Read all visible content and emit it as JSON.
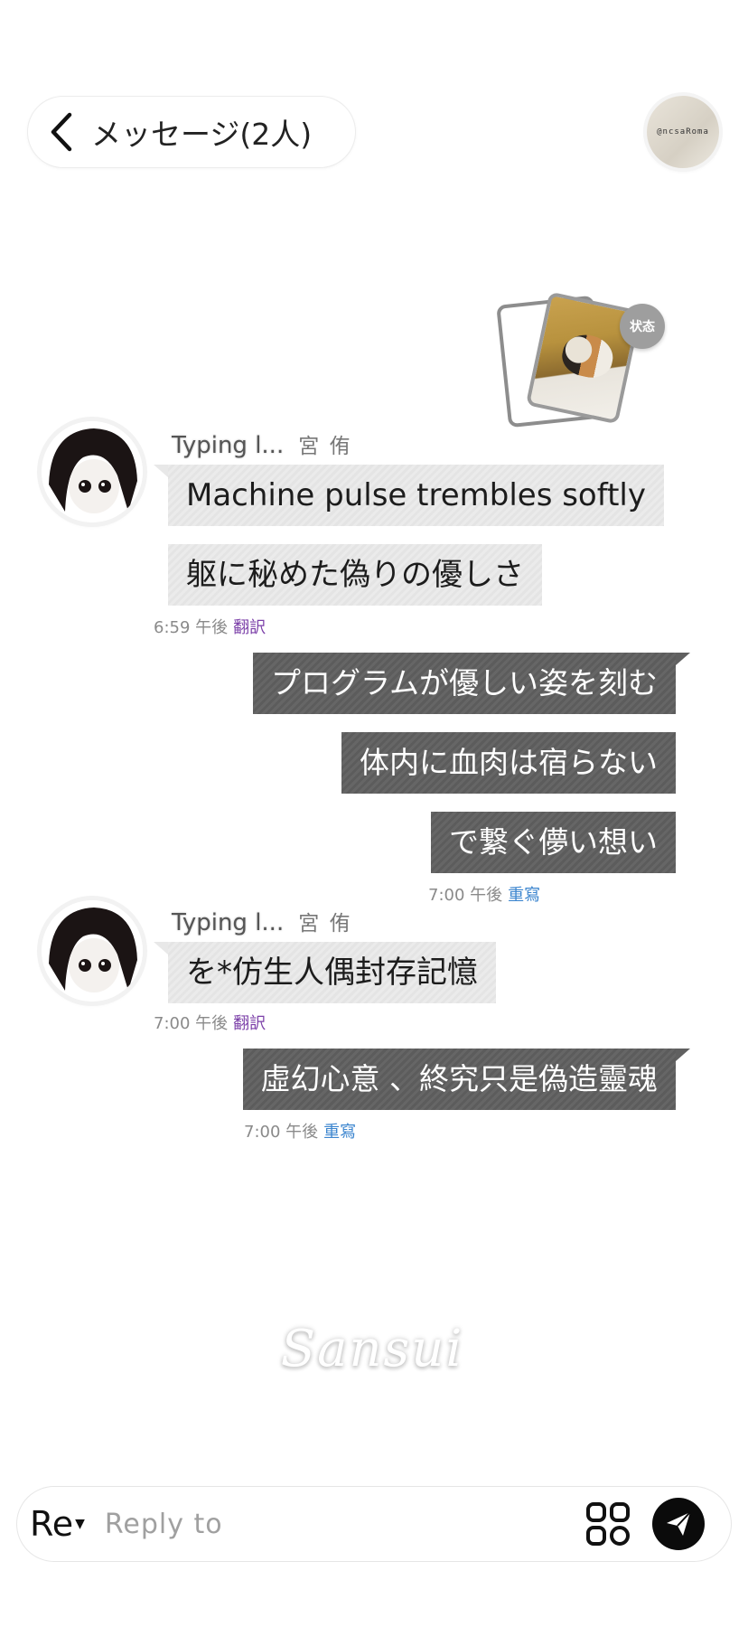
{
  "header": {
    "title": "メッセージ(2人)",
    "avatar_text": "@ncsaRoma"
  },
  "status": {
    "badge_label": "状态"
  },
  "messages": {
    "group1": {
      "typing_name": "Typing l...",
      "sender_name": "宮 侑",
      "bubbles": [
        "Machine pulse trembles softly",
        "躯に秘めた偽りの優しさ"
      ],
      "time": "6:59 午後",
      "action": "翻訳"
    },
    "group2": {
      "bubbles": [
        "プログラムが優しい姿を刻む",
        "体内に血肉は宿らない",
        "で繋ぐ儚い想い"
      ],
      "time": "7:00 午後",
      "action": "重寫"
    },
    "group3": {
      "typing_name": "Typing l...",
      "sender_name": "宮 侑",
      "bubbles": [
        "を*仿生人偶封存記憶"
      ],
      "time": "7:00 午後",
      "action": "翻訳"
    },
    "group4": {
      "bubbles": [
        "虛幻心意 、終究只是偽造靈魂"
      ],
      "time": "7:00 午後",
      "action": "重寫"
    }
  },
  "watermark": "Sansui",
  "composer": {
    "mode_label": "Re",
    "placeholder": "Reply to"
  }
}
